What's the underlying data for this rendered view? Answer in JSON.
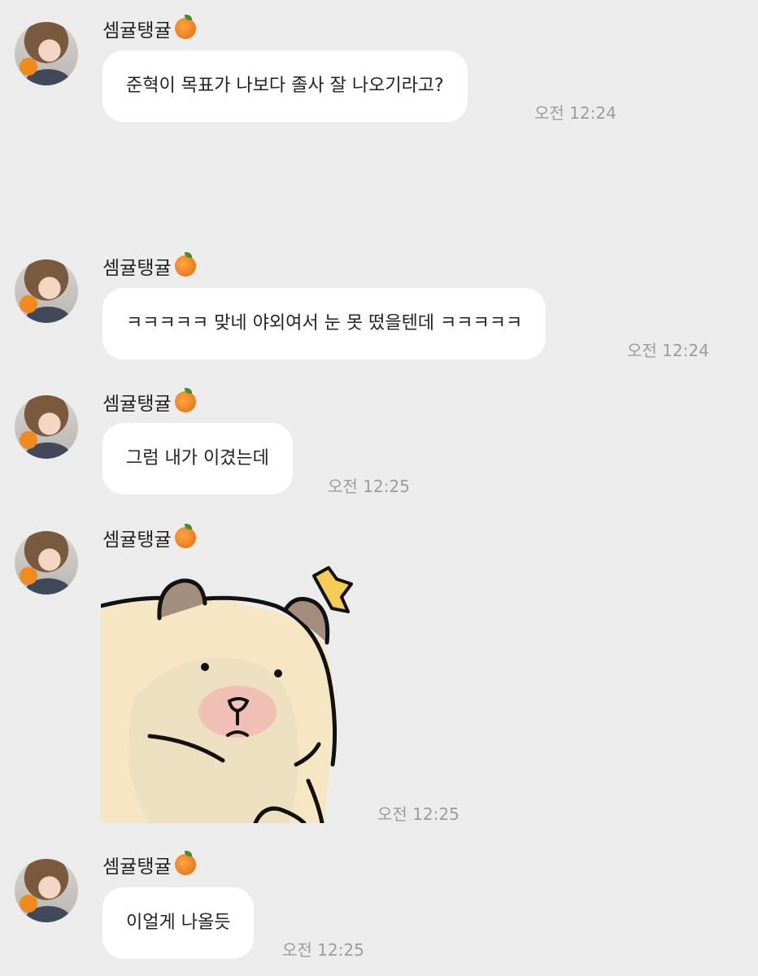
{
  "messages": [
    {
      "sender": "셈귤탱귤",
      "text": "준혁이 목표가 나보다 졸사 잘 나오기라고?",
      "time": "오전 12:24"
    },
    {
      "sender": "셈귤탱귤",
      "text": "ㅋㅋㅋㅋㅋ 맞네 야외여서 눈 못 떴을텐데 ㅋㅋㅋㅋㅋ",
      "time": "오전 12:24"
    },
    {
      "sender": "셈귤탱귤",
      "text": "그럼 내가 이겼는데",
      "time": "오전 12:25"
    },
    {
      "sender": "셈귤탱귤",
      "sticker": "bear-sticker",
      "time": "오전 12:25"
    },
    {
      "sender": "셈귤탱귤",
      "text": "이얼게 나올듯",
      "time": "오전 12:25"
    }
  ],
  "colors": {
    "background": "#ececec",
    "bubble": "#ffffff",
    "time": "#9c9c9c",
    "text": "#222222"
  },
  "icons": {
    "sender_badge": "tangerine-icon"
  }
}
